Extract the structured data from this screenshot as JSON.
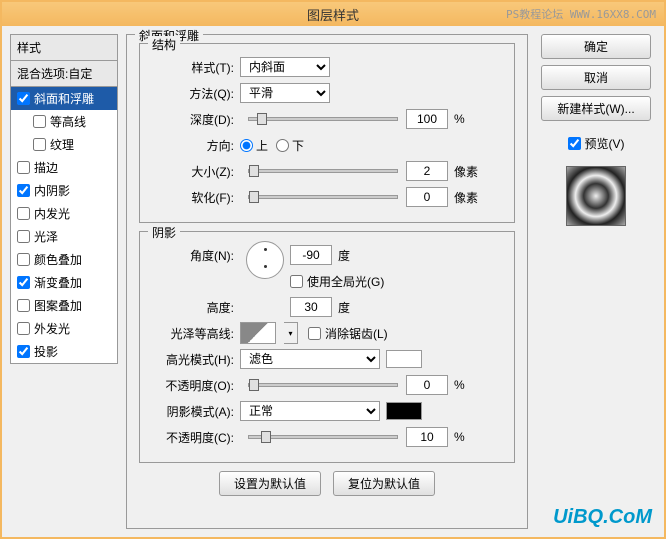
{
  "window": {
    "title": "图层样式"
  },
  "watermarks": {
    "top": "PS教程论坛 WWW.16XX8.COM",
    "bottom": "UiBQ.CoM"
  },
  "left": {
    "header": "样式",
    "blend": "混合选项:自定",
    "items": [
      {
        "label": "斜面和浮雕",
        "checked": true,
        "selected": true
      },
      {
        "label": "等高线",
        "checked": false,
        "indent": true
      },
      {
        "label": "纹理",
        "checked": false,
        "indent": true
      },
      {
        "label": "描边",
        "checked": false
      },
      {
        "label": "内阴影",
        "checked": true
      },
      {
        "label": "内发光",
        "checked": false
      },
      {
        "label": "光泽",
        "checked": false
      },
      {
        "label": "颜色叠加",
        "checked": false
      },
      {
        "label": "渐变叠加",
        "checked": true
      },
      {
        "label": "图案叠加",
        "checked": false
      },
      {
        "label": "外发光",
        "checked": false
      },
      {
        "label": "投影",
        "checked": true
      }
    ]
  },
  "bevel": {
    "section_title": "斜面和浮雕",
    "structure_title": "结构",
    "style_label": "样式(T):",
    "style_value": "内斜面",
    "technique_label": "方法(Q):",
    "technique_value": "平滑",
    "depth_label": "深度(D):",
    "depth_value": "100",
    "depth_unit": "%",
    "direction_label": "方向:",
    "direction_up": "上",
    "direction_down": "下",
    "size_label": "大小(Z):",
    "size_value": "2",
    "size_unit": "像素",
    "soften_label": "软化(F):",
    "soften_value": "0",
    "soften_unit": "像素"
  },
  "shading": {
    "title": "阴影",
    "angle_label": "角度(N):",
    "angle_value": "-90",
    "angle_unit": "度",
    "global_light": "使用全局光(G)",
    "altitude_label": "高度:",
    "altitude_value": "30",
    "altitude_unit": "度",
    "gloss_label": "光泽等高线:",
    "antialias": "消除锯齿(L)",
    "highlight_mode_label": "高光模式(H):",
    "highlight_mode_value": "滤色",
    "highlight_opacity_label": "不透明度(O):",
    "highlight_opacity_value": "0",
    "highlight_opacity_unit": "%",
    "shadow_mode_label": "阴影模式(A):",
    "shadow_mode_value": "正常",
    "shadow_opacity_label": "不透明度(C):",
    "shadow_opacity_value": "10",
    "shadow_opacity_unit": "%"
  },
  "buttons": {
    "set_default": "设置为默认值",
    "reset_default": "复位为默认值",
    "ok": "确定",
    "cancel": "取消",
    "new_style": "新建样式(W)...",
    "preview": "预览(V)"
  }
}
